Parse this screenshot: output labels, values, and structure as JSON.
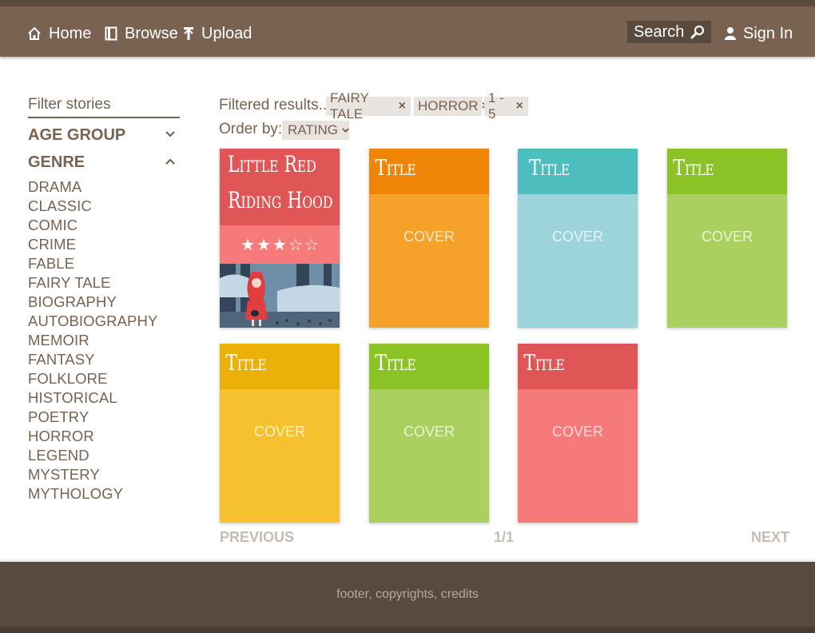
{
  "nav": {
    "home": "Home",
    "browse": "Browse",
    "upload": "Upload",
    "search_placeholder": "Search",
    "signin": "Sign In"
  },
  "sidebar": {
    "title": "Filter stories",
    "groups": [
      {
        "label": "AGE GROUP",
        "expanded": false
      },
      {
        "label": "GENRE",
        "expanded": true
      }
    ],
    "genres": [
      "DRAMA",
      "CLASSIC",
      "COMIC",
      "CRIME",
      "FABLE",
      "FAIRY TALE",
      "BIOGRAPHY",
      "AUTOBIOGRAPHY",
      "MEMOIR",
      "FANTASY",
      "FOLKLORE",
      "HISTORICAL",
      "POETRY",
      "HORROR",
      "LEGEND",
      "MYSTERY",
      "MYTHOLOGY"
    ]
  },
  "filters": {
    "label": "Filtered results...",
    "chips": [
      "FAIRY TALE",
      "HORROR",
      "1 - 5"
    ],
    "remove_glyph": "×",
    "order_label": "Order by:",
    "order_value": "RATING"
  },
  "featured": {
    "title_line1": "Little Red",
    "title_line2": "Riding Hood",
    "rating": 3,
    "max_rating": 5,
    "colors": {
      "title": "#e05555",
      "band": "#f67a7a"
    }
  },
  "cards": [
    {
      "title": "Title",
      "cover": "COVER",
      "title_color": "#ee8507",
      "cover_color": "#f5a12a"
    },
    {
      "title": "Title",
      "cover": "COVER",
      "title_color": "#4dbebd",
      "cover_color": "#9dd3da"
    },
    {
      "title": "Title",
      "cover": "COVER",
      "title_color": "#8bc327",
      "cover_color": "#aad15f"
    },
    {
      "title": "Title",
      "cover": "COVER",
      "title_color": "#ebb108",
      "cover_color": "#f5c12e"
    },
    {
      "title": "Title",
      "cover": "COVER",
      "title_color": "#8bc327",
      "cover_color": "#aad15f"
    },
    {
      "title": "Title",
      "cover": "COVER",
      "title_color": "#e05555",
      "cover_color": "#f67a7a"
    }
  ],
  "pagination": {
    "previous": "PREVIOUS",
    "page": "1/1",
    "next": "NEXT"
  },
  "footer": {
    "text": "footer, copyrights, credits"
  },
  "colors": {
    "header": "#7a6251",
    "footer": "#5a4a3e",
    "text": "#7a6251"
  }
}
